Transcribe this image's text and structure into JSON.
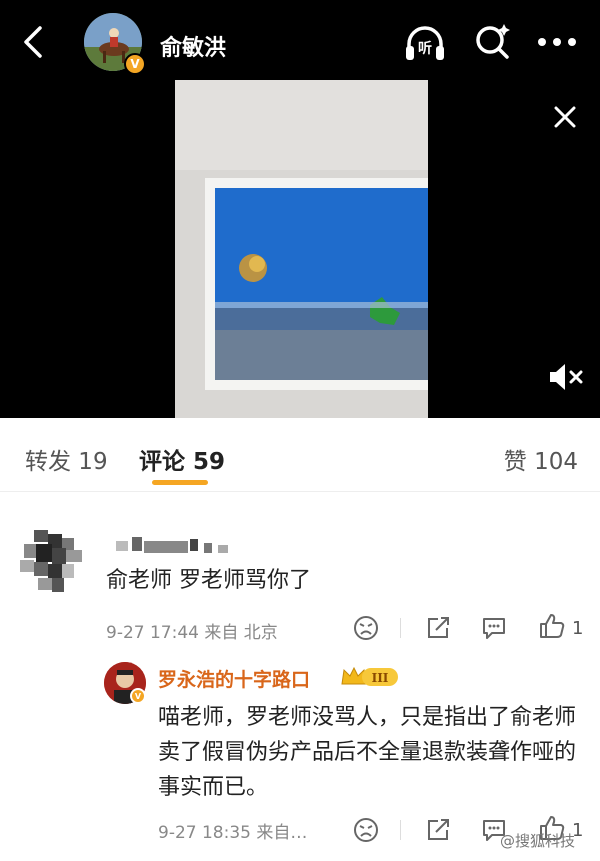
{
  "header": {
    "username": "俞敏洪",
    "listen_label": "听"
  },
  "tabs": {
    "repost": "转发 19",
    "comment": "评论 59",
    "like": "赞 104"
  },
  "comment1": {
    "text": "俞老师 罗老师骂你了",
    "meta": "9-27 17:44  来自 北京",
    "likes": "1"
  },
  "reply": {
    "author": "罗永浩的十字路口",
    "badge_level": "III",
    "text": "喵老师，罗老师没骂人，只是指出了俞老师卖了假冒伪劣产品后不全量退款装聋作哑的事实而已。",
    "meta": "9-27 18:35  来自…",
    "likes": "1"
  },
  "watermark": "@搜狐科技",
  "colors": {
    "accent": "#f5a623",
    "reply_name": "#d9661a"
  }
}
